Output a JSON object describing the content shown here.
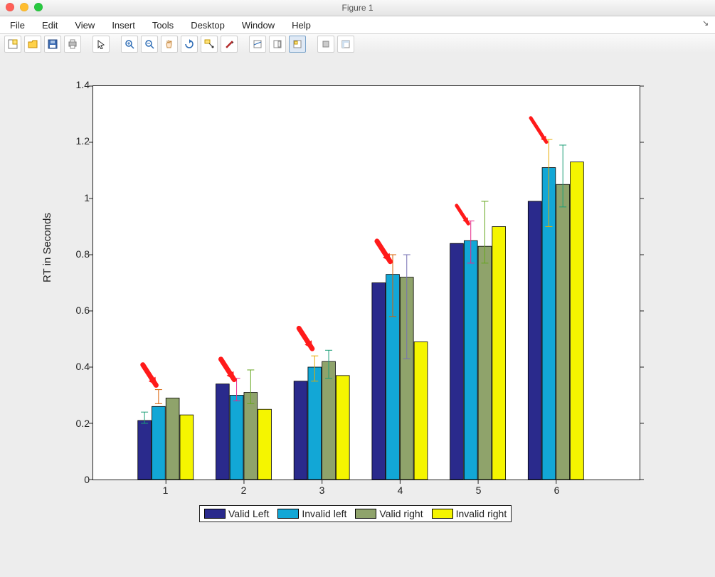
{
  "window": {
    "title": "Figure 1"
  },
  "menus": [
    "File",
    "Edit",
    "View",
    "Insert",
    "Tools",
    "Desktop",
    "Window",
    "Help"
  ],
  "toolbar_icons": [
    "new-figure-icon",
    "open-icon",
    "save-icon",
    "print-icon",
    "sep",
    "pointer-icon",
    "sep",
    "zoom-in-icon",
    "zoom-out-icon",
    "pan-icon",
    "rotate-icon",
    "data-cursor-icon",
    "brush-icon",
    "sep",
    "insert-colorbar-icon",
    "insert-legend-icon",
    "link-plots-icon",
    "sep",
    "hide-plot-tools-icon",
    "show-plot-tools-icon"
  ],
  "chart_data": {
    "type": "bar",
    "ylabel": "RT in Seconds",
    "xlabel": "",
    "categories": [
      "1",
      "2",
      "3",
      "4",
      "5",
      "6"
    ],
    "ylim": [
      0,
      1.4
    ],
    "yticks": [
      0,
      0.2,
      0.4,
      0.6,
      0.8,
      1.0,
      1.2,
      1.4
    ],
    "series": [
      {
        "name": "Valid Left",
        "values": [
          0.21,
          0.34,
          0.35,
          0.7,
          0.84,
          0.99
        ],
        "color": "#2a2a8c"
      },
      {
        "name": "Invalid left",
        "values": [
          0.26,
          0.3,
          0.4,
          0.73,
          0.85,
          1.11
        ],
        "color": "#12a7d6"
      },
      {
        "name": "Valid right",
        "values": [
          0.29,
          0.31,
          0.42,
          0.72,
          0.83,
          1.05
        ],
        "color": "#8fa36b"
      },
      {
        "name": "Invalid right",
        "values": [
          0.23,
          0.25,
          0.37,
          0.49,
          0.9,
          1.13
        ],
        "color": "#f5f500"
      }
    ],
    "error_bars": {
      "1": [
        {
          "x": 1,
          "low": 0.2,
          "high": 0.24,
          "comment": "off-center tiny"
        },
        {
          "x": 2,
          "low": 0.27,
          "high": 0.32
        }
      ],
      "2": [
        {
          "x": 2,
          "low": 0.28,
          "high": 0.36
        },
        {
          "x": 3,
          "low": 0.27,
          "high": 0.39
        }
      ],
      "3": [
        {
          "x": 2,
          "low": 0.35,
          "high": 0.44
        },
        {
          "x": 3,
          "low": 0.36,
          "high": 0.46
        }
      ],
      "4": [
        {
          "x": 2,
          "low": 0.58,
          "high": 0.8
        },
        {
          "x": 3,
          "low": 0.43,
          "high": 0.8
        }
      ],
      "5": [
        {
          "x": 2,
          "low": 0.77,
          "high": 0.92
        },
        {
          "x": 3,
          "low": 0.77,
          "high": 0.99
        }
      ],
      "6": [
        {
          "x": 2,
          "low": 0.9,
          "high": 1.21
        },
        {
          "x": 3,
          "low": 0.97,
          "high": 1.19
        }
      ]
    },
    "annotations": {
      "red_arrows_at_groups": [
        1,
        2,
        3,
        4,
        5,
        6
      ]
    },
    "legend": [
      "Valid Left",
      "Invalid left",
      "Valid right",
      "Invalid right"
    ]
  }
}
